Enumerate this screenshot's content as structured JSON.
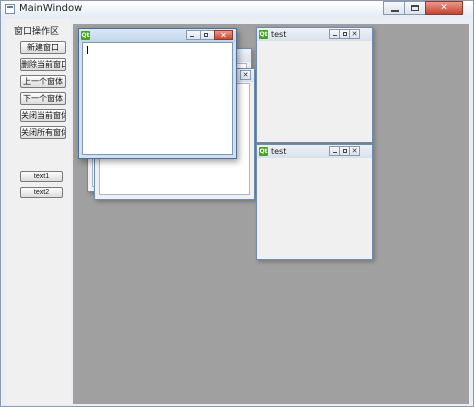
{
  "window": {
    "title": "MainWindow"
  },
  "sidebar": {
    "title": "窗口操作区",
    "buttons": {
      "new": "新建窗口",
      "delete_current": "删除当前窗口",
      "previous": "上一个窗体",
      "next": "下一个窗体",
      "close_current": "关闭当前窗体",
      "close_all": "关闭所有窗体",
      "text1": "text1",
      "text2": "text2"
    }
  },
  "subwindows": {
    "right_top": {
      "title": "test"
    },
    "right_bottom": {
      "title": "test"
    }
  },
  "icons": {
    "qt": "Qt",
    "window_app": "window-icon"
  },
  "colors": {
    "mdi_background": "#a0a0a0",
    "qt_green": "#44a51c",
    "close_red": "#c5422e"
  }
}
